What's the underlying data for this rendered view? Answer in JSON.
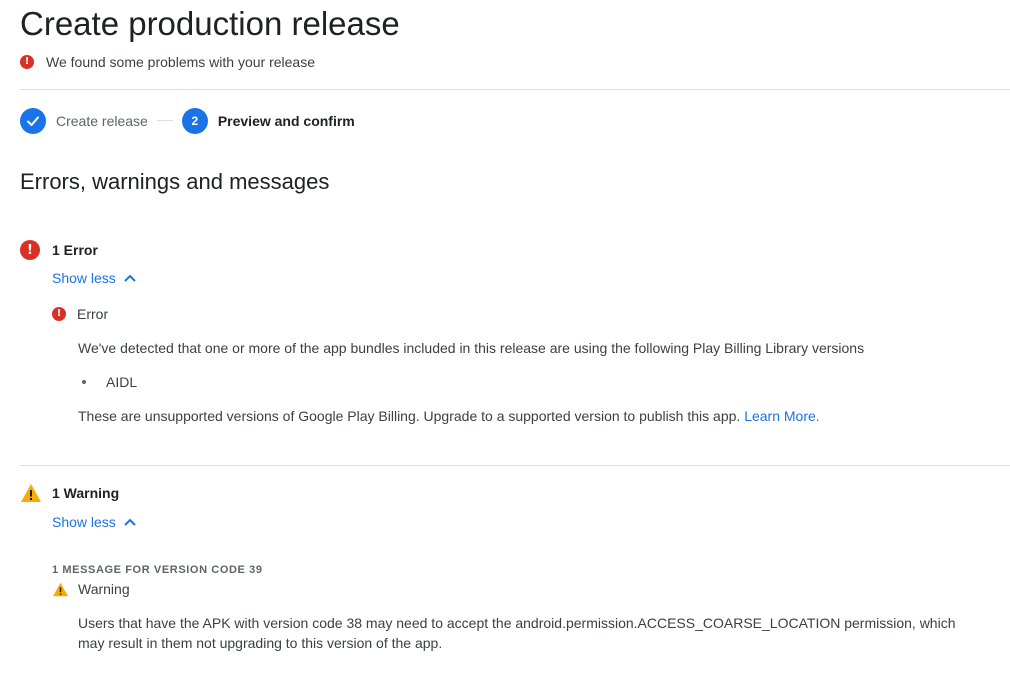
{
  "header": {
    "title": "Create production release",
    "problems_text": "We found some problems with your release"
  },
  "stepper": {
    "step1_label": "Create release",
    "step2_number": "2",
    "step2_label": "Preview and confirm"
  },
  "section": {
    "title": "Errors, warnings and messages"
  },
  "errors": {
    "summary": "1 Error",
    "toggle_label": "Show less",
    "item": {
      "title": "Error",
      "description": "We've detected that one or more of the app bundles included in this release are using the following Play Billing Library versions",
      "bullets": [
        "AIDL"
      ],
      "note": "These are unsupported versions of Google Play Billing. Upgrade to a supported version to publish this app.",
      "link_label": "Learn More."
    }
  },
  "warnings": {
    "summary": "1 Warning",
    "toggle_label": "Show less",
    "version_caption": "1 MESSAGE FOR VERSION CODE 39",
    "item": {
      "title": "Warning",
      "description": "Users that have the APK with version code 38 may need to accept the android.permission.ACCESS_COARSE_LOCATION permission, which may result in them not upgrading to this version of the app."
    }
  },
  "colors": {
    "accent": "#1a73e8",
    "error": "#d93025",
    "warning": "#f9ab00",
    "divider": "#dadce0"
  }
}
